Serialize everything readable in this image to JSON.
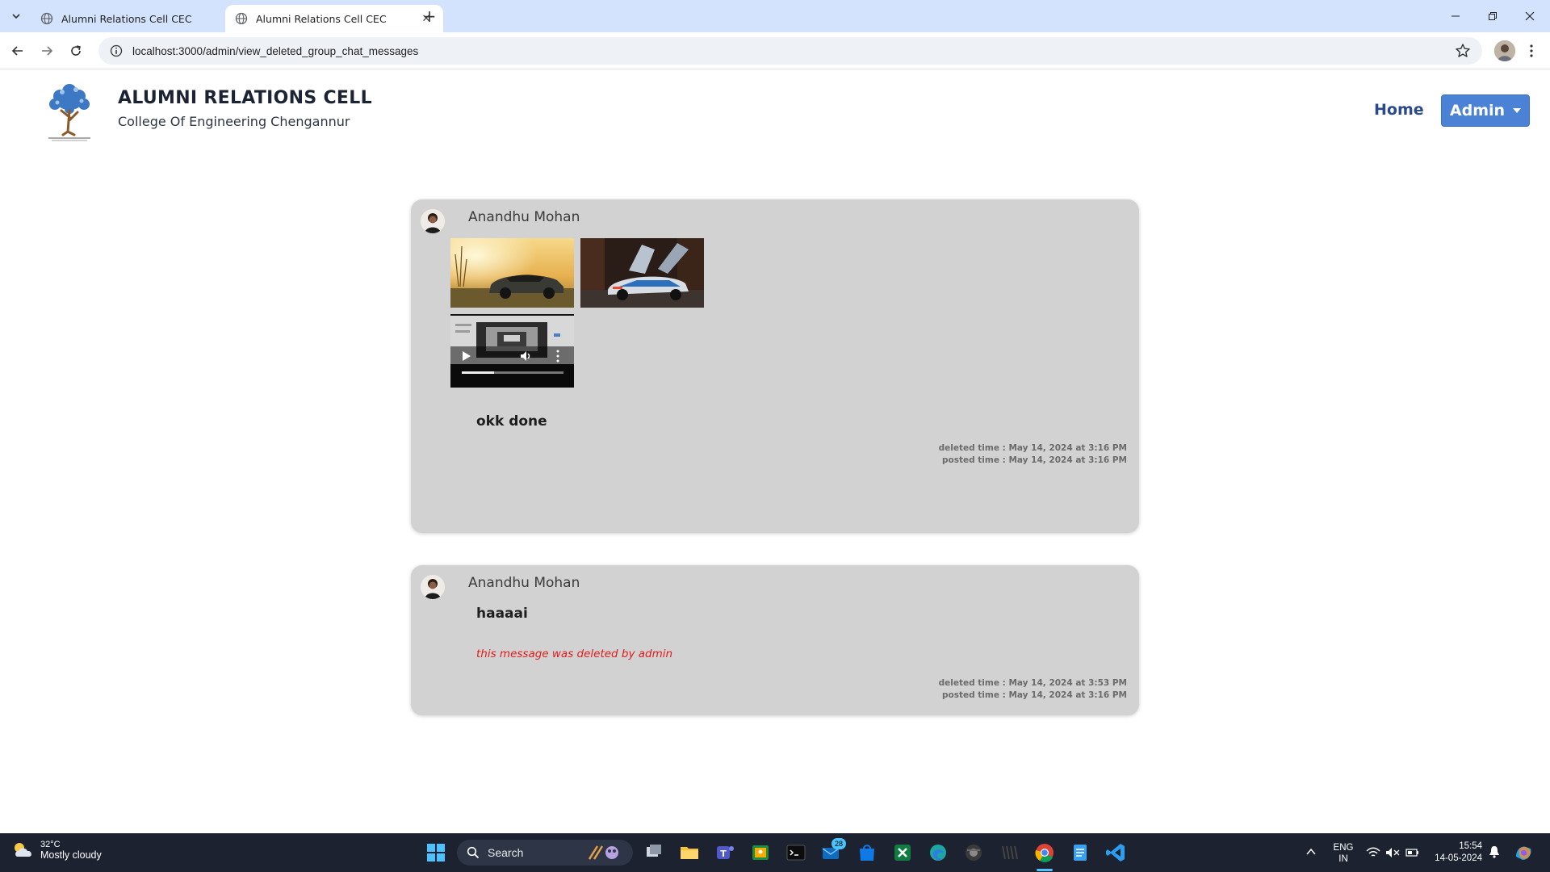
{
  "browser": {
    "tabs": [
      {
        "title": "Alumni Relations Cell CEC",
        "active": false
      },
      {
        "title": "Alumni Relations Cell CEC",
        "active": true
      }
    ],
    "url": "localhost:3000/admin/view_deleted_group_chat_messages"
  },
  "header": {
    "title": "ALUMNI RELATIONS CELL",
    "subtitle": "College Of Engineering Chengannur",
    "nav_home": "Home",
    "nav_admin": "Admin"
  },
  "messages": [
    {
      "sender": "Anandhu Mohan",
      "text": "okk done",
      "media": [
        "car-photo-golden-sunset",
        "car-photo-gullwing-doors",
        "video-player"
      ],
      "deleted_time": "deleted time : May 14, 2024 at 3:16 PM",
      "posted_time": "posted time : May 14, 2024 at 3:16 PM"
    },
    {
      "sender": "Anandhu Mohan",
      "text": "haaaai",
      "deleted_note": "this message was deleted by admin",
      "deleted_time": "deleted time : May 14, 2024 at 3:53 PM",
      "posted_time": "posted time : May 14, 2024 at 3:16 PM"
    }
  ],
  "taskbar": {
    "weather_temp": "32°C",
    "weather_cond": "Mostly cloudy",
    "search_label": "Search",
    "mail_badge": "28",
    "lang_top": "ENG",
    "lang_bottom": "IN",
    "time": "15:54",
    "date": "14-05-2024"
  },
  "colors": {
    "accent": "#4c82d6",
    "card": "#d3d2d2",
    "deleted_note": "#e11b1b"
  }
}
